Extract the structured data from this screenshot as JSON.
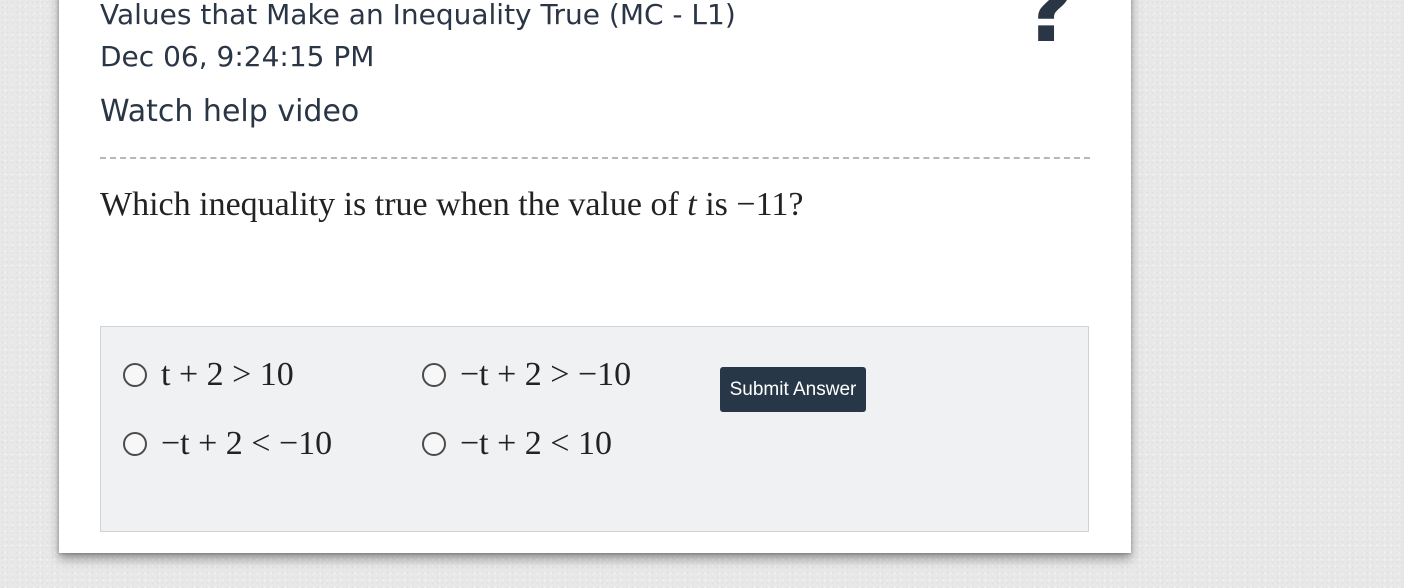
{
  "header": {
    "title": "Values that Make an Inequality True (MC - L1)",
    "timestamp": "Dec 06, 9:24:15 PM",
    "help_link": "Watch help video",
    "help_icon_glyph": "?"
  },
  "question": {
    "text_before": "Which inequality is true when the value of ",
    "variable": "t",
    "text_middle": " is ",
    "value": "−11",
    "text_after": "?"
  },
  "options": [
    {
      "label": "t + 2 > 10"
    },
    {
      "label": "−t + 2 > −10"
    },
    {
      "label": "−t + 2 < −10"
    },
    {
      "label": "−t + 2 < 10"
    }
  ],
  "submit": {
    "label": "Submit Answer",
    "color": "#273747"
  },
  "icons": {
    "help": "question-mark-icon",
    "radio": "radio-button-icon"
  }
}
